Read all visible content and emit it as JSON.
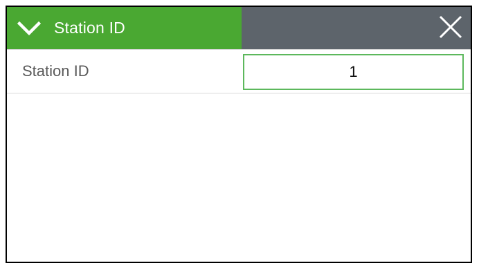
{
  "header": {
    "title": "Station ID",
    "collapse_icon": "chevron-down-icon",
    "close_icon": "close-icon",
    "accent_color": "#4aa832",
    "bar_color": "#5d646b"
  },
  "fields": [
    {
      "label": "Station ID",
      "value": "1"
    }
  ]
}
